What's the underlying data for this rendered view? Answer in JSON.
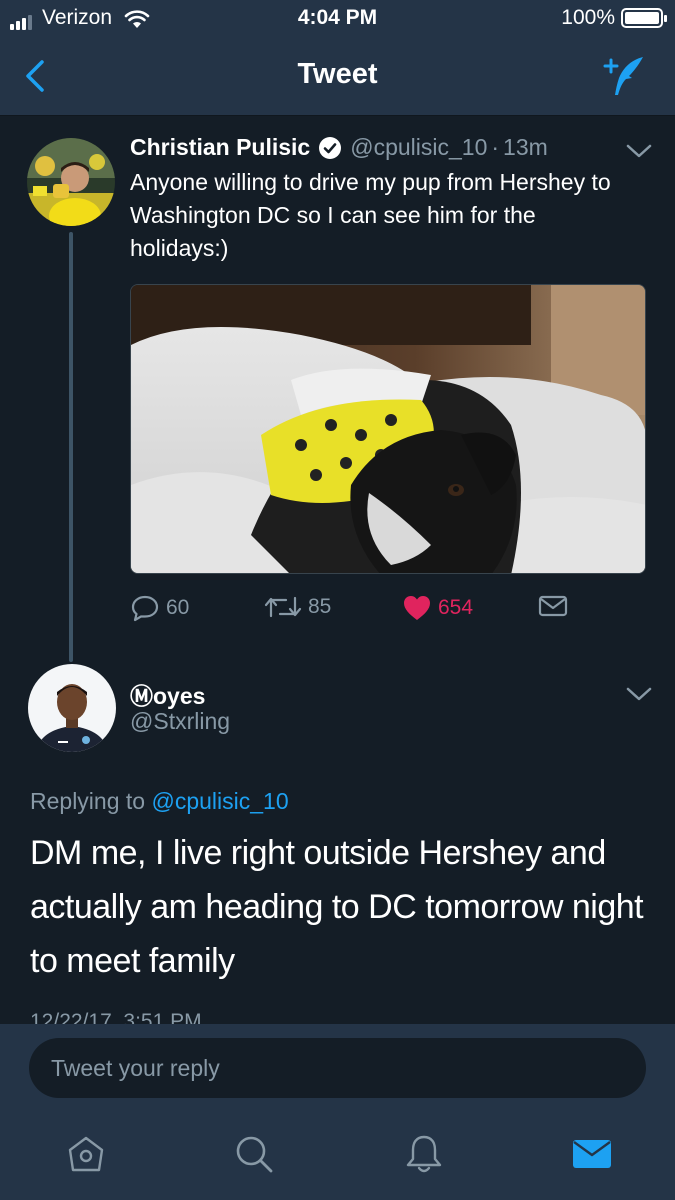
{
  "status_bar": {
    "carrier": "Verizon",
    "time": "4:04 PM",
    "battery": "100%"
  },
  "nav": {
    "title": "Tweet",
    "back_icon": "chevron-left-icon",
    "compose_icon": "compose-tweet-icon"
  },
  "tweet": {
    "author_name": "Christian Pulisic",
    "verified": true,
    "handle": "@cpulisic_10",
    "separator": "·",
    "age": "13m",
    "text": "Anyone willing to drive my pup from Hershey to Washington DC so I can see him for the holidays:)",
    "media": "photo of a black-and-white dog wearing a yellow BVB bandana on a bed",
    "stats": {
      "replies": "60",
      "retweets": "85",
      "likes": "654",
      "liked": true
    }
  },
  "reply": {
    "author_name": "Ⓜoyes",
    "handle": "@Stxrling",
    "replying_prefix": "Replying to",
    "replying_to": "@cpulisic_10",
    "text": "DM me, I live right outside Hershey and actually am heading to DC tomorrow night to meet family",
    "timestamp": "12/22/17, 3:51 PM"
  },
  "composer": {
    "placeholder": "Tweet your reply"
  },
  "tabs": [
    {
      "name": "home-icon",
      "active": false
    },
    {
      "name": "search-icon",
      "active": false
    },
    {
      "name": "notifications-icon",
      "active": false
    },
    {
      "name": "messages-icon",
      "active": true
    }
  ],
  "colors": {
    "background": "#141d26",
    "bar": "#243447",
    "accent": "#1da1f2",
    "like": "#e0245e",
    "muted": "#8899a6"
  }
}
